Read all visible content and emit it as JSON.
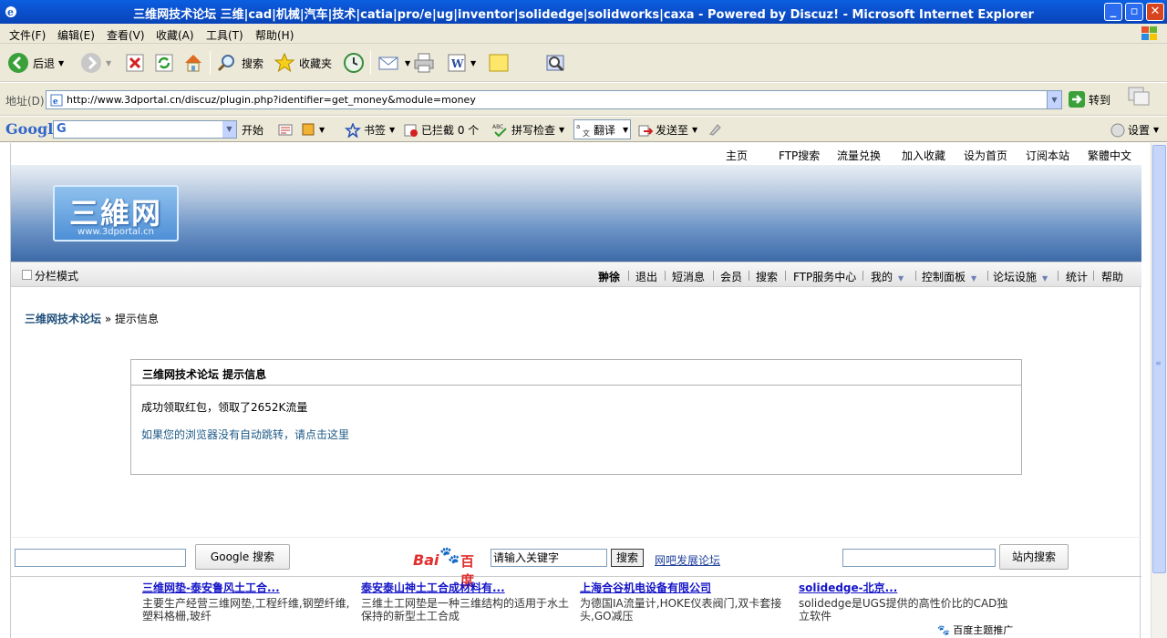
{
  "window": {
    "title": "三维网技术论坛 三维|cad|机械|汽车|技术|catia|pro/e|ug|inventor|solidedge|solidworks|caxa - Powered by Discuz! - Microsoft Internet Explorer"
  },
  "menu": [
    "文件(F)",
    "编辑(E)",
    "查看(V)",
    "收藏(A)",
    "工具(T)",
    "帮助(H)"
  ],
  "toolbar": {
    "back": "后退",
    "search": "搜索",
    "favorites": "收藏夹"
  },
  "address": {
    "label": "地址(D)",
    "url": "http://www.3dportal.cn/discuz/plugin.php?identifier=get_money&module=money",
    "go": "转到"
  },
  "google_bar": {
    "logo": "Google",
    "start": "开始",
    "bookmarks": "书签",
    "blocked": "已拦截 0 个",
    "spellcheck": "拼写检查",
    "translate": "翻译",
    "sendto": "发送至",
    "settings": "设置"
  },
  "site": {
    "top_links": [
      "主页",
      "FTP搜索",
      "流量兑换",
      "加入收藏",
      "设为首页",
      "订阅本站",
      "繁體中文"
    ],
    "logo_cn": "三維网",
    "logo_en": "www.3dportal.cn",
    "column_mode": "分栏模式",
    "nav": [
      "翀徐",
      "退出",
      "短消息",
      "会员",
      "搜索",
      "FTP服务中心",
      "我的",
      "控制面板",
      "论坛设施",
      "统计",
      "帮助"
    ],
    "breadcrumb_home": "三维网技术论坛",
    "breadcrumb_sep": "»",
    "breadcrumb_current": "提示信息",
    "message_title": "三维网技术论坛  提示信息",
    "message_text": "成功领取红包，领取了2652K流量",
    "message_link": "如果您的浏览器没有自动跳转，请点击这里",
    "google_search_btn": "Google 搜索",
    "baidu_placeholder": "请输入关键字",
    "baidu_btn": "搜索",
    "baidu_link": "网吧发展论坛",
    "site_search_btn": "站内搜索",
    "baidu_logo_left": "Bai",
    "baidu_logo_right": "百度",
    "ads": [
      {
        "title": "三维网垫-泰安鲁风土工合...",
        "desc": "主要生产经营三维网垫,工程纤维,钢塑纤维,塑料格栅,玻纤"
      },
      {
        "title": "泰安泰山神土工合成材料有...",
        "desc": "三维土工网垫是一种三维结构的适用于水土保持的新型土工合成"
      },
      {
        "title": "上海合谷机电设备有限公司",
        "desc": "为德国IA流量计,HOKE仪表阀门,双卡套接头,GO减压"
      },
      {
        "title": "solidedge-北京...",
        "desc": "solidedge是UGS提供的高性价比的CAD独立软件"
      }
    ],
    "baidu_promo": "百度主题推广"
  }
}
